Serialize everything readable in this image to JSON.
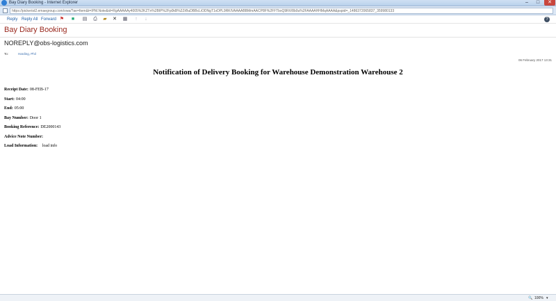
{
  "window": {
    "title": "Bay Diary Booking - Internet Explorer",
    "url": "https://pickerist2.emaegroup.com/owa/?ae=Item&t=IPM.Note&id=RgAAAAAy4005%2KZTn%2BIP%2Fp0kB%2ZrBuDBBcLiODNgT1vDPL9RKIVAAAABBMmAACP8F%2FFTbxQ9RiV8b0u%2FAAAAHHMqAAAA&pspid=_1486372065837_359980133",
    "minimize_glyph": "–",
    "maximize_glyph": "□",
    "close_glyph": "✕"
  },
  "toolbar": {
    "reply_label": "Reply",
    "reply_all_label": "Reply All",
    "forward_label": "Forward",
    "help_glyph": "?"
  },
  "message": {
    "subject": "Bay Diary Booking",
    "sender": "NOREPLY@obs-logistics.com",
    "to_label": "To:",
    "to_value": "Harding, Phil",
    "date": "06 February 2017 13:31"
  },
  "body": {
    "title": "Notification of Delivery Booking for Warehouse Demonstration Warehouse 2",
    "fields": [
      {
        "label": "Receipt Date:",
        "value": "08-FEB-17"
      },
      {
        "label": "Start:",
        "value": "04:00"
      },
      {
        "label": "End:",
        "value": "05:00"
      },
      {
        "label": "Bay Number:",
        "value": "Door 1"
      },
      {
        "label": "Booking Reference:",
        "value": "DE2000143"
      },
      {
        "label": "Advice Note Number:",
        "value": ""
      },
      {
        "label": "Load Information:",
        "value": "   load info"
      }
    ]
  },
  "statusbar": {
    "zoom": "100%",
    "zoom_caret": "▾"
  }
}
